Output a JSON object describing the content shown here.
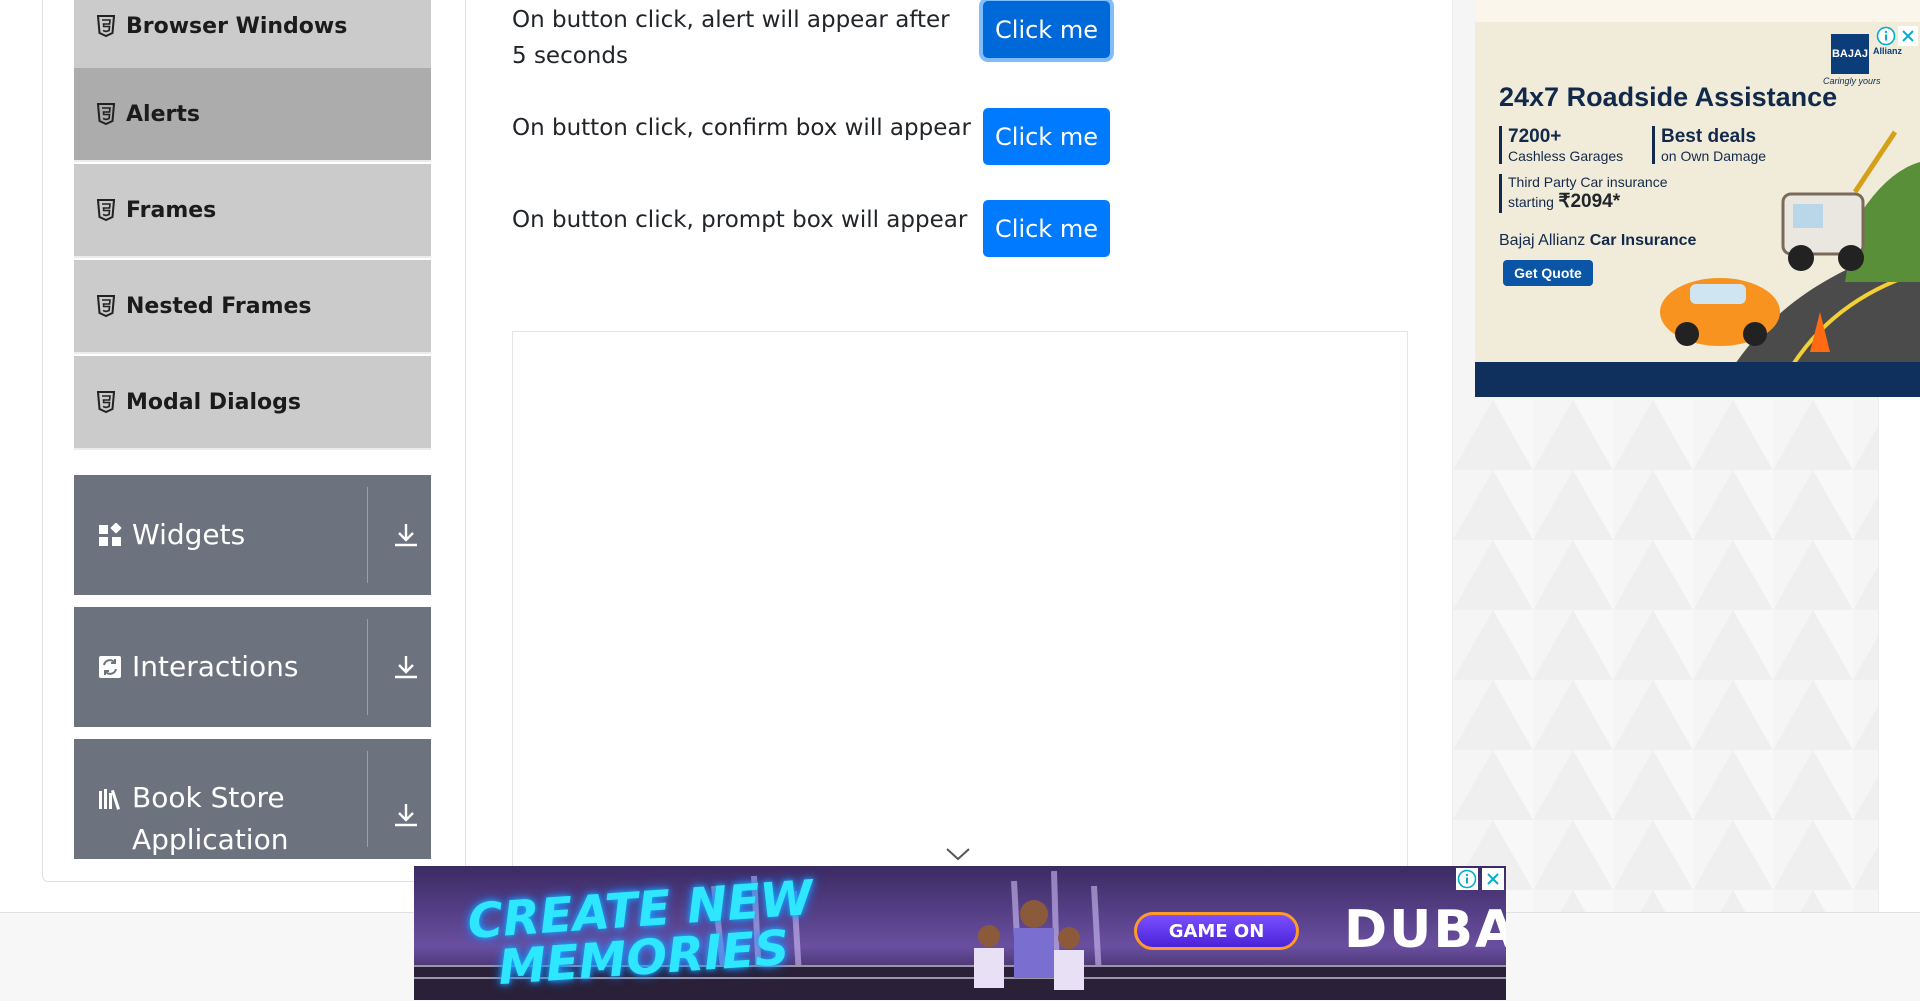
{
  "nav": {
    "sub_items": [
      {
        "label": "Browser Windows",
        "icon": "html5-icon",
        "active": false
      },
      {
        "label": "Alerts",
        "icon": "html5-icon",
        "active": true
      },
      {
        "label": "Frames",
        "icon": "html5-icon",
        "active": false
      },
      {
        "label": "Nested Frames",
        "icon": "html5-icon",
        "active": false
      },
      {
        "label": "Modal Dialogs",
        "icon": "html5-icon",
        "active": false
      }
    ],
    "groups": [
      {
        "label": "Widgets",
        "icon": "widgets-icon"
      },
      {
        "label": "Interactions",
        "icon": "interactions-icon"
      },
      {
        "label": "Book Store Application",
        "icon": "books-icon"
      }
    ]
  },
  "alerts": {
    "rows": [
      {
        "text": "On button click, alert will appear after 5 seconds",
        "button": "Click me"
      },
      {
        "text": "On button click, confirm box will appear",
        "button": "Click me"
      },
      {
        "text": "On button click, prompt box will appear",
        "button": "Click me"
      }
    ]
  },
  "ad_top": {
    "title": "24x7 Roadside Assistance",
    "stat1_big": "7200+",
    "stat1_small": "Cashless Garages",
    "stat2_big": "Best deals",
    "stat2_small": "on Own Damage",
    "tp_line1": "Third Party Car insurance",
    "tp_line2": "starting",
    "tp_price": "₹2094*",
    "brand_prefix": "Bajaj Allianz",
    "brand_bold": "Car Insurance",
    "cta": "Get Quote",
    "logo": "BAJAJ",
    "logo_sub": "Caringly yours",
    "brand_right": "Allianz"
  },
  "ad_bottom": {
    "headline": "CREATE NEW MEMORIES",
    "cta": "GAME ON",
    "brand": "DUBAI"
  },
  "colors": {
    "primary_button": "#007bff",
    "nav_group_bg": "#6c737e",
    "nav_sub_bg": "#cbcbcb",
    "nav_active_bg": "#acacac"
  }
}
